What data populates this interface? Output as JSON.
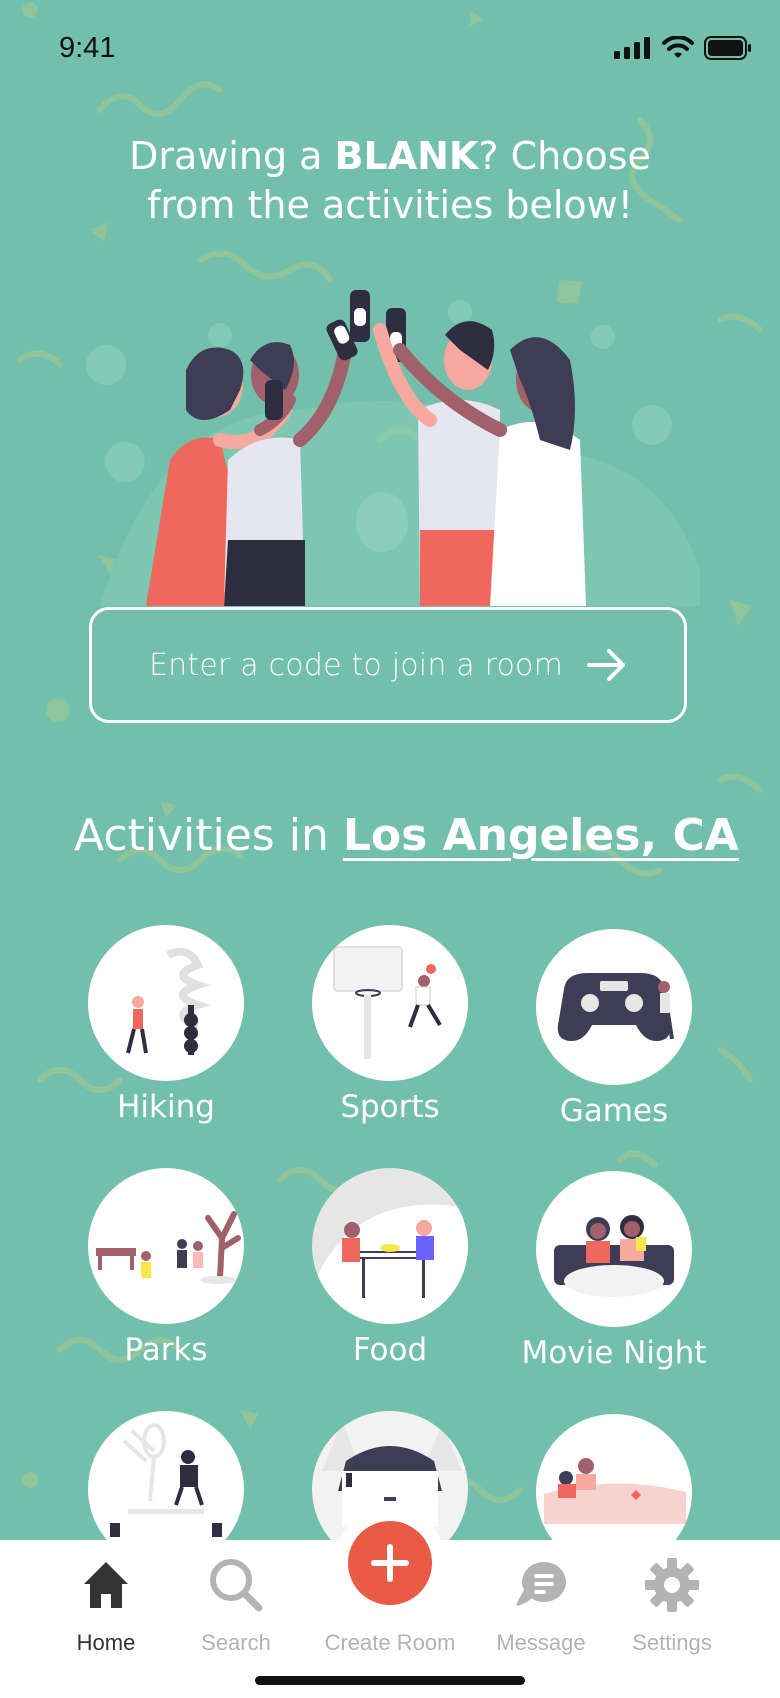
{
  "status_bar": {
    "time": "9:41"
  },
  "headline": {
    "pre": "Drawing a ",
    "bold": "BLANK",
    "post": "? Choose from the activities below!"
  },
  "join": {
    "placeholder": "Enter a code to join a room"
  },
  "section": {
    "title_prefix": "Activities in ",
    "location": "Los Angeles, CA"
  },
  "activities": [
    {
      "label": "Hiking",
      "icon": "hiking-illustration"
    },
    {
      "label": "Sports",
      "icon": "basketball-illustration"
    },
    {
      "label": "Games",
      "icon": "gamepad-illustration"
    },
    {
      "label": "Parks",
      "icon": "park-illustration"
    },
    {
      "label": "Food",
      "icon": "dining-illustration"
    },
    {
      "label": "Movie Night",
      "icon": "movie-night-illustration"
    },
    {
      "label": "",
      "icon": "music-illustration"
    },
    {
      "label": "",
      "icon": "camping-illustration"
    },
    {
      "label": "",
      "icon": "beach-illustration"
    }
  ],
  "tabbar": {
    "items": [
      {
        "label": "Home",
        "icon": "home-icon",
        "active": true
      },
      {
        "label": "Search",
        "icon": "search-icon",
        "active": false
      },
      {
        "label": "Create Room",
        "icon": "plus-icon",
        "active": false
      },
      {
        "label": "Message",
        "icon": "message-icon",
        "active": false
      },
      {
        "label": "Settings",
        "icon": "gear-icon",
        "active": false
      }
    ]
  },
  "colors": {
    "background": "#72c0ab",
    "accent": "#e95b44",
    "tab_active": "#333333",
    "tab_inactive": "#b3b3b3"
  }
}
